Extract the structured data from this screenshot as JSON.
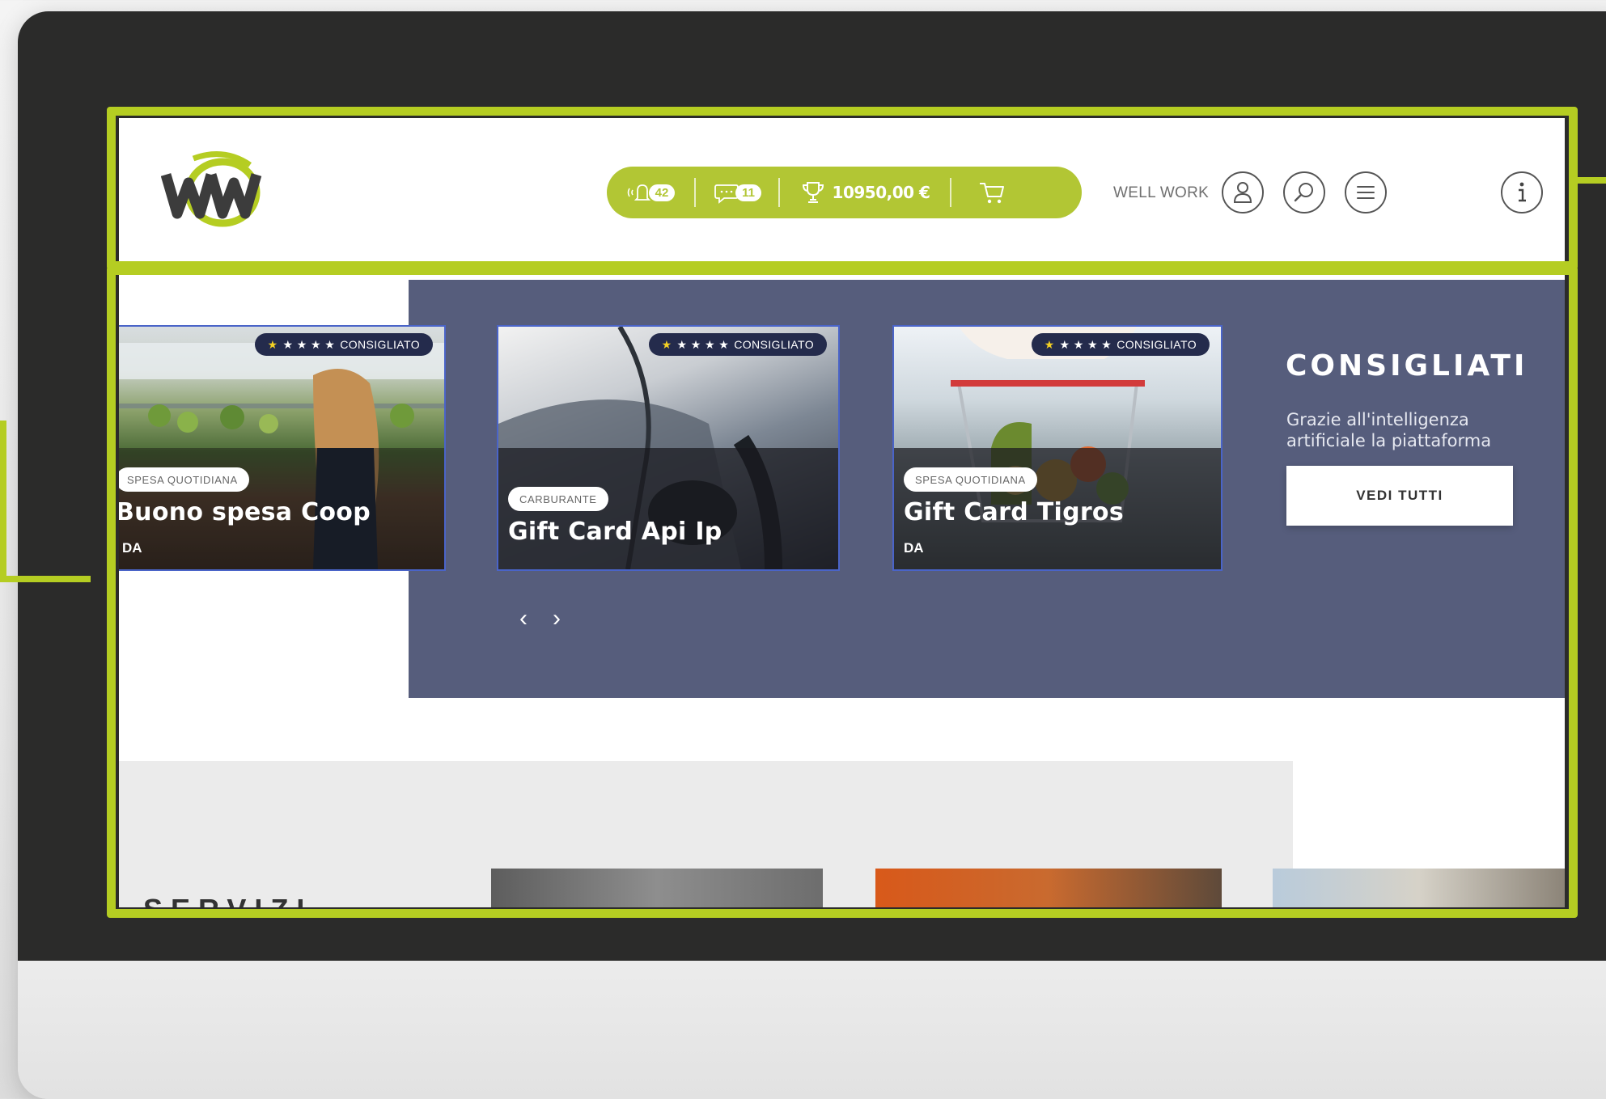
{
  "header": {
    "notifications_count": "42",
    "messages_count": "11",
    "points_amount": "10950,00 €",
    "company_name": "WELL WORK"
  },
  "recommended": {
    "title": "CONSIGLIATI",
    "description": "Grazie all'intelligenza artificiale la piattaforma caratterizzata...",
    "button_label": "VEDI TUTTI",
    "badge_label": "CONSIGLIATO",
    "cards": [
      {
        "category": "SPESA QUOTIDIANA",
        "title": "Buono spesa Coop",
        "from_label": "DA"
      },
      {
        "category": "CARBURANTE",
        "title": "Gift Card Api Ip",
        "from_label": ""
      },
      {
        "category": "SPESA QUOTIDIANA",
        "title": "Gift Card Tigros",
        "from_label": "DA"
      }
    ]
  },
  "services": {
    "title": "SERVIZI"
  },
  "colors": {
    "accent": "#b5cd22",
    "pill": "#b2c634",
    "band": "#565d7c",
    "badge": "#242b4c",
    "bezel": "#2b2b2a"
  },
  "icons": [
    "bell-icon",
    "chat-icon",
    "trophy-icon",
    "cart-icon",
    "user-icon",
    "search-icon",
    "menu-icon",
    "info-icon",
    "chevron-left-icon",
    "chevron-right-icon",
    "star-icon"
  ]
}
